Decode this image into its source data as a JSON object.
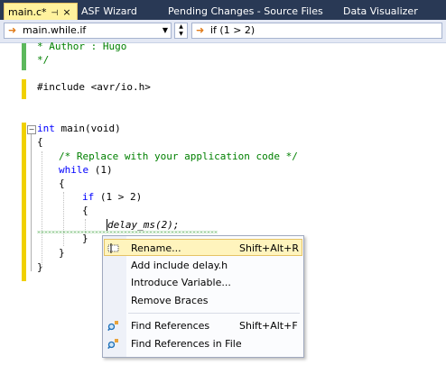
{
  "tabs": [
    {
      "label": "main.c*",
      "pin": "⊣",
      "close": "×"
    },
    {
      "label": "ASF Wizard"
    },
    {
      "label": "Pending Changes - Source Files"
    },
    {
      "label": "Data Visualizer"
    }
  ],
  "navbar": {
    "scope_value": "main.while.if",
    "member_value": "if (1 > 2)"
  },
  "code": {
    "line_author": "* Author : Hugo",
    "line_comment_end": "*/",
    "line_include": "#include <avr/io.h>",
    "line_main_kw": "int",
    "line_main_rest": " main(void)",
    "line_open1": "{",
    "line_replace": "/* Replace with your application code */",
    "line_while_kw": "while",
    "line_while_rest": " (1)",
    "line_open2": "{",
    "line_if_kw": "if",
    "line_if_rest": " (1 > 2)",
    "line_open3": "{",
    "line_delay": "delay_ms(2);",
    "line_close3": "}",
    "line_close2": "}",
    "line_close1": "}"
  },
  "context_menu": {
    "items": [
      {
        "label": "Rename...",
        "shortcut": "Shift+Alt+R",
        "icon": "rename-icon"
      },
      {
        "label": "Add include delay.h",
        "shortcut": ""
      },
      {
        "label": "Introduce Variable...",
        "shortcut": ""
      },
      {
        "label": "Remove Braces",
        "shortcut": ""
      },
      {
        "label": "Find References",
        "shortcut": "Shift+Alt+F",
        "icon": "find-references-icon"
      },
      {
        "label": "Find References in File",
        "shortcut": "",
        "icon": "find-references-file-icon"
      }
    ]
  },
  "colors": {
    "tab_bar": "#293955",
    "active_tab": "#fff29d",
    "comment": "#008000",
    "keyword": "#0000ff",
    "change_saved": "#5cb85c",
    "change_unsaved": "#f0d000",
    "menu_highlight": "#fff4bd"
  }
}
